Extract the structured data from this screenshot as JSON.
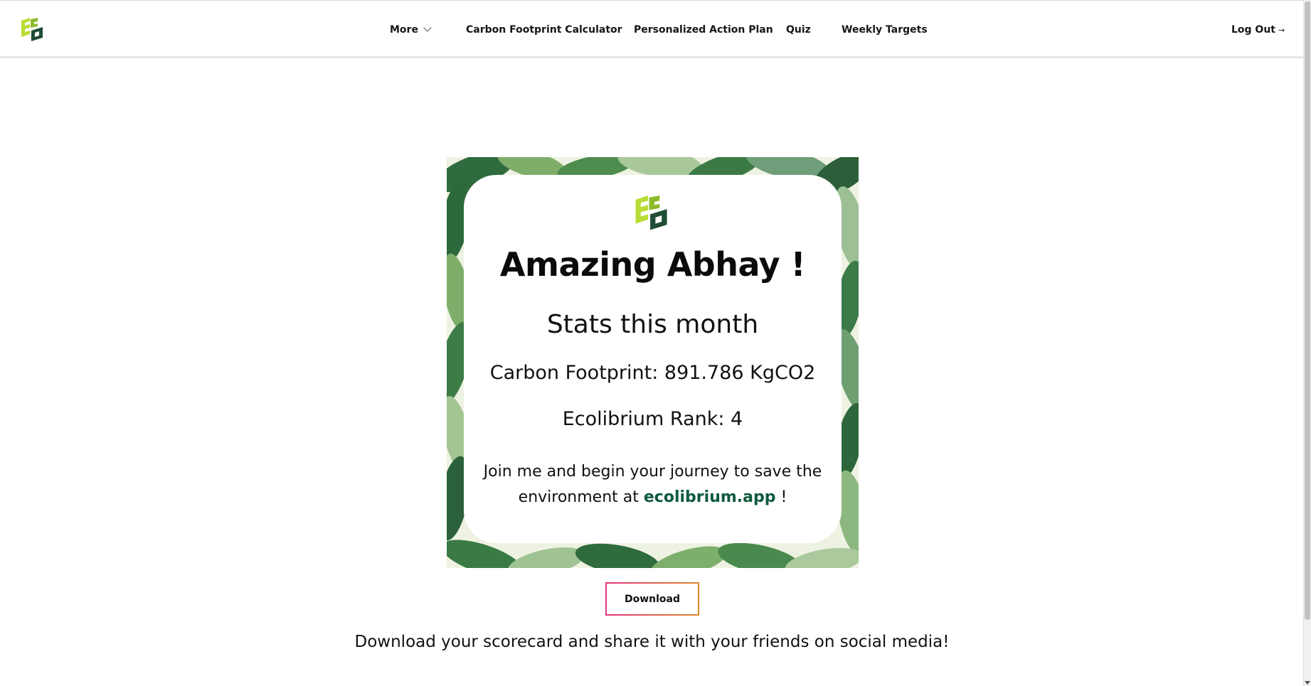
{
  "nav": {
    "logo": "ecolibrium-logo",
    "items": [
      {
        "label": "More",
        "icon": "chevron-down-icon"
      },
      {
        "label": "Carbon Footprint Calculator"
      },
      {
        "label": "Personalized Action Plan"
      },
      {
        "label": "Quiz"
      },
      {
        "label": "Weekly Targets"
      }
    ],
    "logout_label": "Log Out",
    "logout_arrow": "→"
  },
  "scorecard": {
    "title": "Amazing Abhay !",
    "subtitle": "Stats this month",
    "footprint": "Carbon Footprint: 891.786 KgCO2",
    "rank": "Ecolibrium Rank: 4",
    "join_text_before": "Join me and begin your journey to save the environment at",
    "join_link": "ecolibrium.app",
    "join_text_after": "!"
  },
  "download": {
    "button_label": "Download",
    "caption": "Download your scorecard and share it with your friends on social media!"
  },
  "colors": {
    "logo_light": "#b9dd35",
    "logo_mid": "#8cbc2a",
    "logo_dark": "#1f4d36",
    "link_green": "#0d5a3c",
    "button_border_start": "#e0357d",
    "button_border_end": "#d98a2e"
  }
}
